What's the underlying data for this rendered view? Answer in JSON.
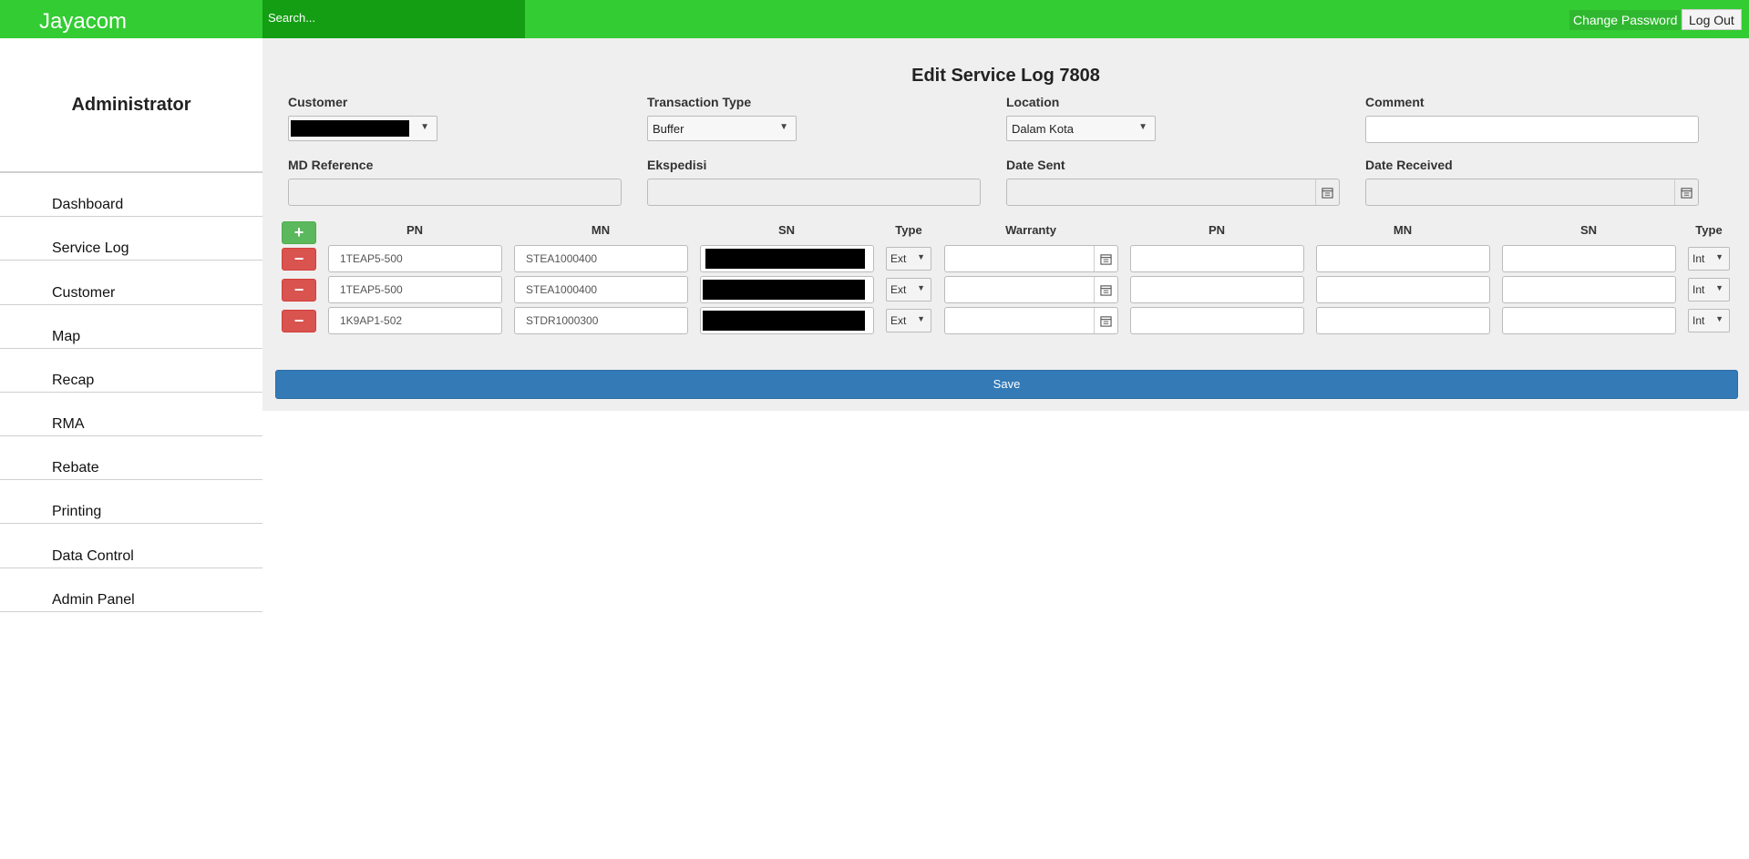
{
  "header": {
    "brand": "Jayacom",
    "search_placeholder": "Search...",
    "change_password": "Change Password",
    "logout": "Log Out"
  },
  "sidebar": {
    "title": "Administrator",
    "items": [
      {
        "label": "Dashboard"
      },
      {
        "label": "Service Log"
      },
      {
        "label": "Customer"
      },
      {
        "label": "Map"
      },
      {
        "label": "Recap"
      },
      {
        "label": "RMA"
      },
      {
        "label": "Rebate"
      },
      {
        "label": "Printing"
      },
      {
        "label": "Data Control"
      },
      {
        "label": "Admin Panel"
      }
    ]
  },
  "form": {
    "title": "Edit Service Log 7808",
    "customer_label": "Customer",
    "transaction_type_label": "Transaction Type",
    "transaction_type_value": "Buffer",
    "location_label": "Location",
    "location_value": "Dalam Kota",
    "comment_label": "Comment",
    "md_reference_label": "MD Reference",
    "ekspedisi_label": "Ekspedisi",
    "date_sent_label": "Date Sent",
    "date_received_label": "Date Received"
  },
  "table": {
    "headers": {
      "pn": "PN",
      "mn": "MN",
      "sn": "SN",
      "type": "Type",
      "warranty": "Warranty",
      "pn2": "PN",
      "mn2": "MN",
      "sn2": "SN",
      "type2": "Type"
    },
    "add_symbol": "+",
    "remove_symbol": "−",
    "rows": [
      {
        "pn": "1TEAP5-500",
        "mn": "STEA1000400",
        "type": "Ext",
        "type2": "Int"
      },
      {
        "pn": "1TEAP5-500",
        "mn": "STEA1000400",
        "type": "Ext",
        "type2": "Int"
      },
      {
        "pn": "1K9AP1-502",
        "mn": "STDR1000300",
        "type": "Ext",
        "type2": "Int"
      }
    ]
  },
  "save_label": "Save"
}
